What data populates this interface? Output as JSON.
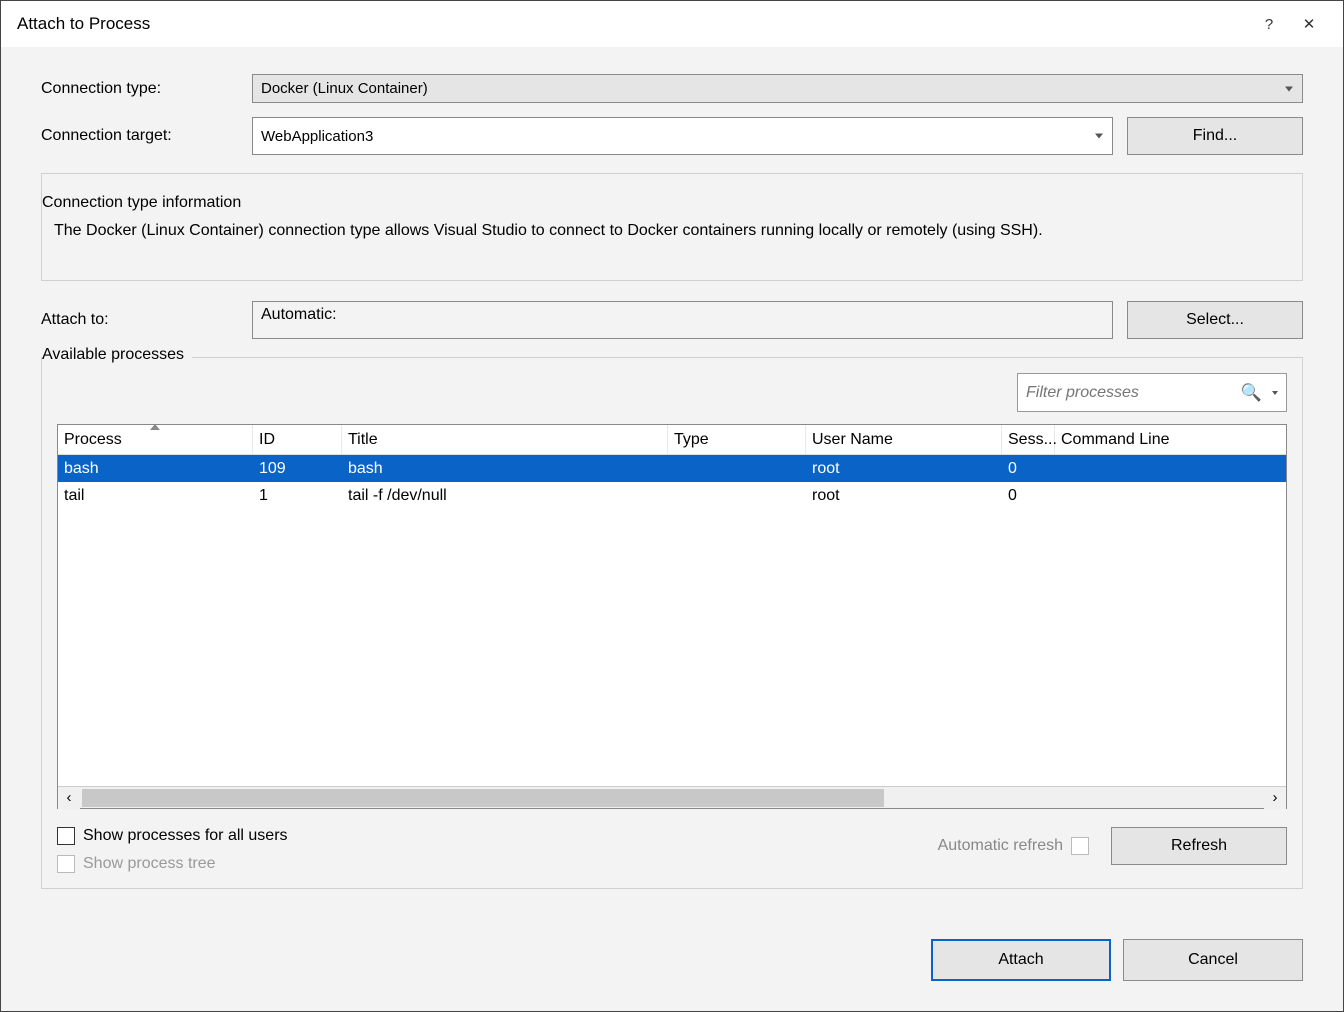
{
  "titlebar": {
    "title": "Attach to Process",
    "help": "?",
    "close": "✕"
  },
  "form": {
    "connection_type_label": "Connection type:",
    "connection_type_value": "Docker (Linux Container)",
    "connection_target_label": "Connection target:",
    "connection_target_value": "WebApplication3",
    "find_button": "Find..."
  },
  "info": {
    "heading": "Connection type information",
    "text": "The Docker (Linux Container) connection type allows Visual Studio to connect to Docker containers running locally or remotely (using SSH)."
  },
  "attach": {
    "label": "Attach to:",
    "value": "Automatic:",
    "select_button": "Select..."
  },
  "processes": {
    "heading": "Available processes",
    "filter_placeholder": "Filter processes",
    "columns": {
      "process": "Process",
      "id": "ID",
      "title": "Title",
      "type": "Type",
      "user": "User Name",
      "sess": "Sess...",
      "cmd": "Command Line"
    },
    "rows": [
      {
        "process": "bash",
        "id": "109",
        "title": "bash",
        "type": "",
        "user": "root",
        "sess": "0",
        "cmd": "",
        "selected": true
      },
      {
        "process": "tail",
        "id": "1",
        "title": "tail -f /dev/null",
        "type": "",
        "user": "root",
        "sess": "0",
        "cmd": "",
        "selected": false
      }
    ],
    "show_all_users": "Show processes for all users",
    "show_tree": "Show process tree",
    "auto_refresh": "Automatic refresh",
    "refresh_button": "Refresh"
  },
  "footer": {
    "attach": "Attach",
    "cancel": "Cancel"
  }
}
